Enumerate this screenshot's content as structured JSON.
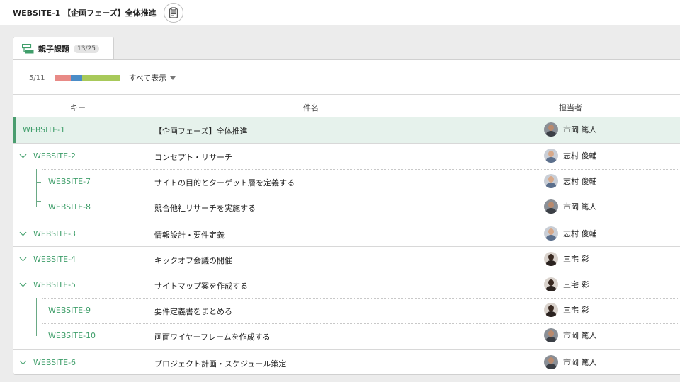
{
  "header": {
    "title": "WEBSITE-1 【企画フェーズ】全体推進",
    "copy_icon": "clipboard-icon"
  },
  "tab": {
    "icon": "parent-child-icon",
    "label": "親子課題",
    "badge": "13/25"
  },
  "progress": {
    "text": "5/11",
    "segments": [
      {
        "status": "open",
        "color": "#e88a86",
        "fraction": 0.25
      },
      {
        "status": "in-progress",
        "color": "#4a8cc7",
        "fraction": 0.17
      },
      {
        "status": "resolved",
        "color": "#a8c95a",
        "fraction": 0.58
      }
    ],
    "filter_label": "すべて表示"
  },
  "columns": {
    "key": "キー",
    "subject": "件名",
    "assignee": "担当者"
  },
  "colors": {
    "accent": "#3f9e6a",
    "active_row": "#e6f2ec"
  },
  "rows": [
    {
      "key": "WEBSITE-1",
      "subject": "【企画フェーズ】全体推進",
      "assignee": "市岡 篤人",
      "avatar": "man-dark"
    },
    {
      "key": "WEBSITE-2",
      "subject": "コンセプト・リサーチ",
      "assignee": "志村 俊輔",
      "avatar": "man-glasses"
    },
    {
      "key": "WEBSITE-7",
      "subject": "サイトの目的とターゲット層を定義する",
      "assignee": "志村 俊輔",
      "avatar": "man-glasses"
    },
    {
      "key": "WEBSITE-8",
      "subject": "競合他社リサーチを実施する",
      "assignee": "市岡 篤人",
      "avatar": "man-dark"
    },
    {
      "key": "WEBSITE-3",
      "subject": "情報設計・要件定義",
      "assignee": "志村 俊輔",
      "avatar": "man-glasses"
    },
    {
      "key": "WEBSITE-4",
      "subject": "キックオフ会議の開催",
      "assignee": "三宅 彩",
      "avatar": "woman"
    },
    {
      "key": "WEBSITE-5",
      "subject": "サイトマップ案を作成する",
      "assignee": "三宅 彩",
      "avatar": "woman"
    },
    {
      "key": "WEBSITE-9",
      "subject": "要件定義書をまとめる",
      "assignee": "三宅 彩",
      "avatar": "woman"
    },
    {
      "key": "WEBSITE-10",
      "subject": "画面ワイヤーフレームを作成する",
      "assignee": "市岡 篤人",
      "avatar": "man-dark"
    },
    {
      "key": "WEBSITE-6",
      "subject": "プロジェクト計画・スケジュール策定",
      "assignee": "市岡 篤人",
      "avatar": "man-dark"
    }
  ]
}
